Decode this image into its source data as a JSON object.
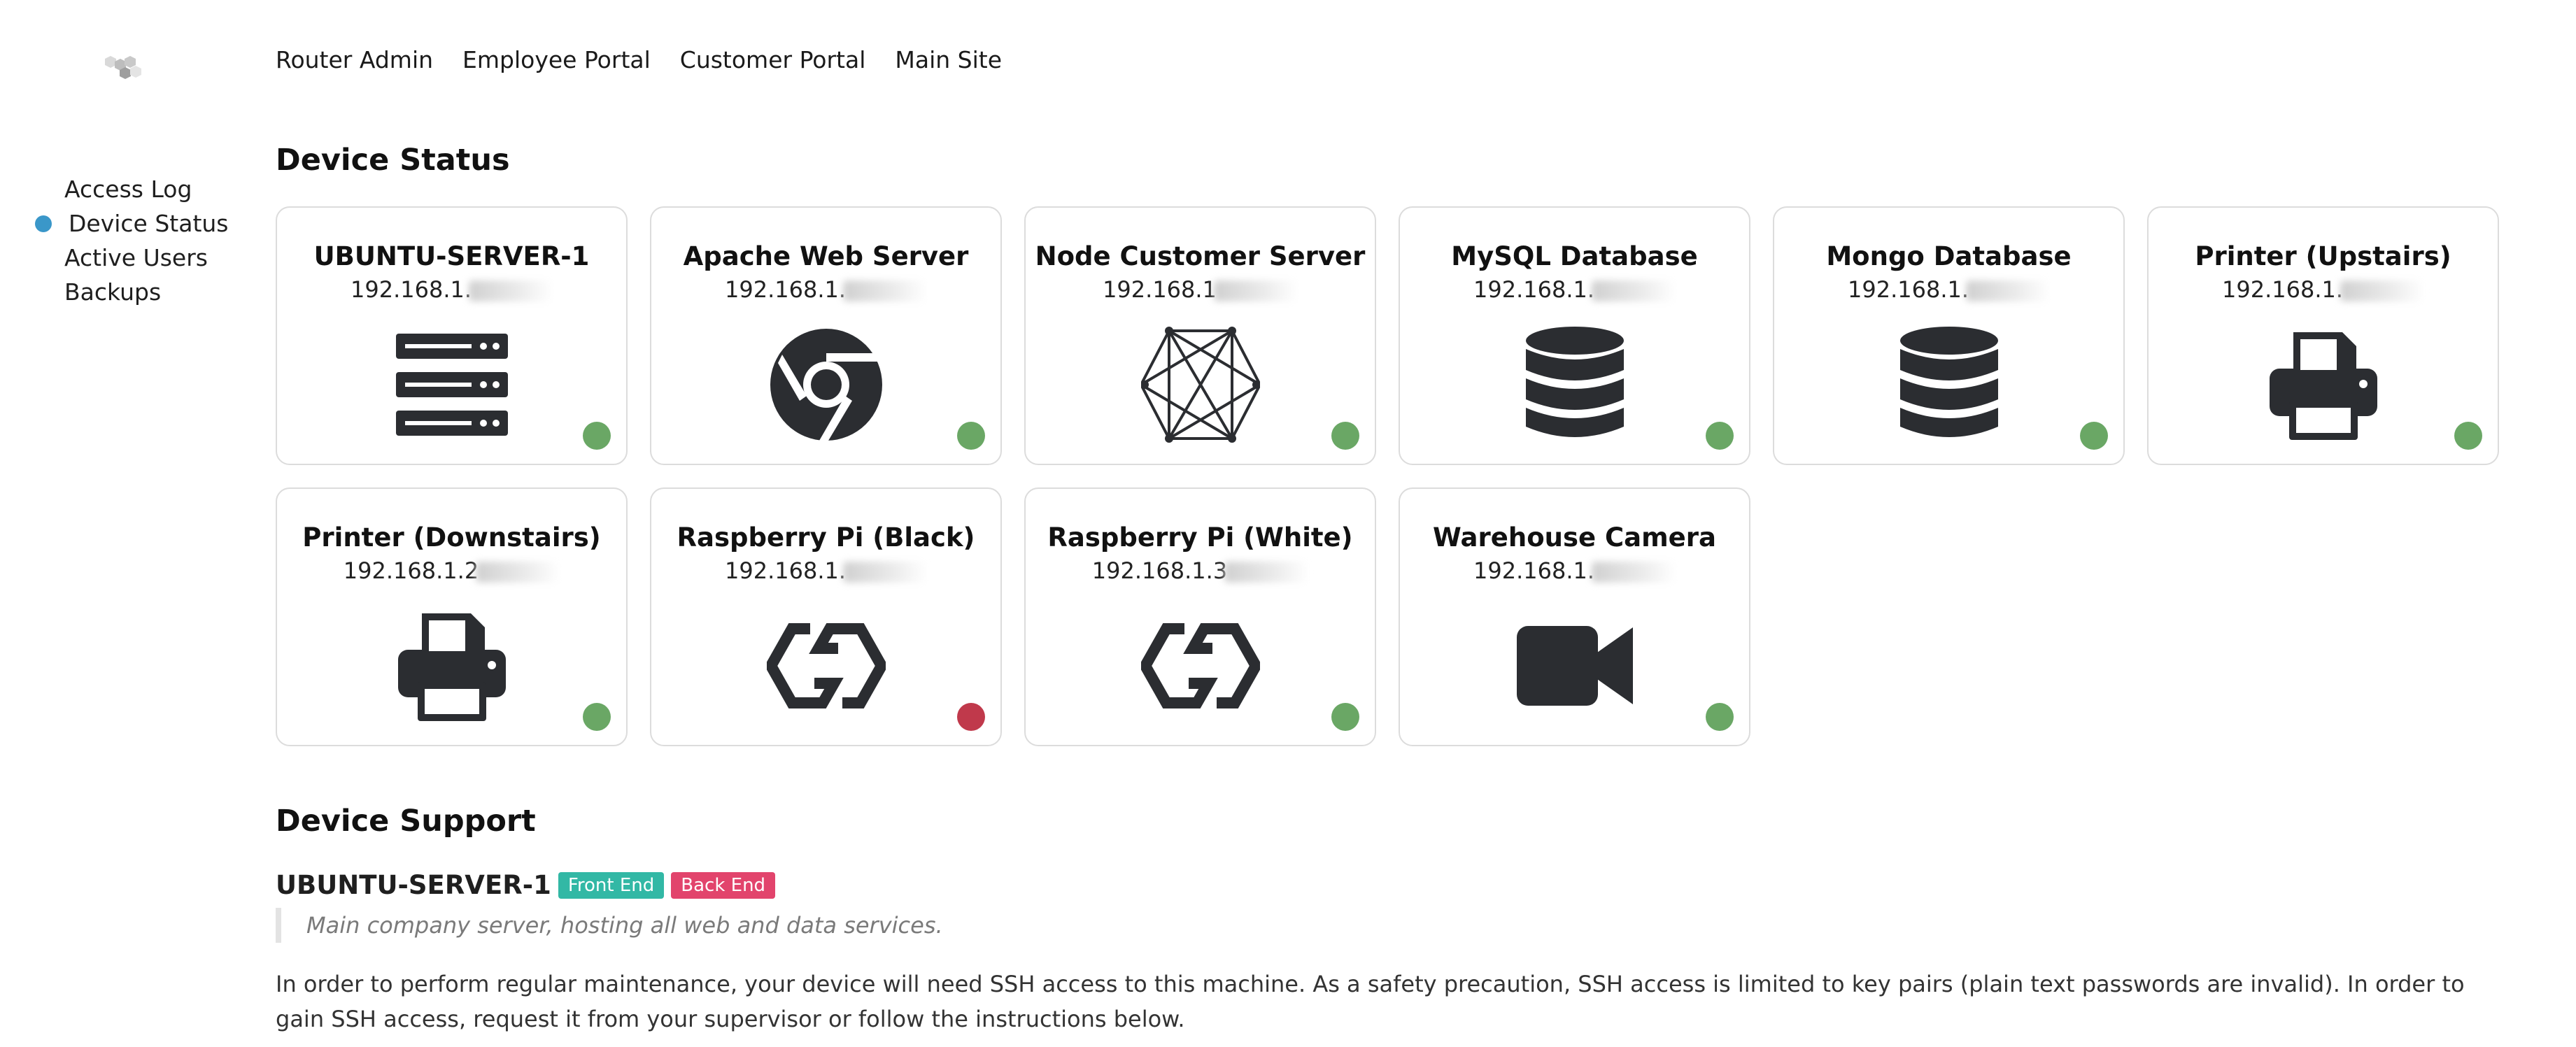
{
  "logo": "hexagon-cluster-logo",
  "topnav": [
    "Router Admin",
    "Employee Portal",
    "Customer Portal",
    "Main Site"
  ],
  "sidenav": {
    "items": [
      {
        "label": "Access Log",
        "active": false
      },
      {
        "label": "Device Status",
        "active": true
      },
      {
        "label": "Active Users",
        "active": false
      },
      {
        "label": "Backups",
        "active": false
      }
    ]
  },
  "device_status": {
    "heading": "Device Status",
    "devices": [
      {
        "name": "UBUNTU-SERVER-1",
        "ip": "192.168.1.",
        "icon": "server-icon",
        "status": "online"
      },
      {
        "name": "Apache Web Server",
        "ip": "192.168.1.",
        "icon": "chrome-icon",
        "status": "online"
      },
      {
        "name": "Node Customer Server",
        "ip": "192.168.1",
        "icon": "hexagon-network-icon",
        "status": "online"
      },
      {
        "name": "MySQL Database",
        "ip": "192.168.1.",
        "icon": "database-icon",
        "status": "online"
      },
      {
        "name": "Mongo Database",
        "ip": "192.168.1.",
        "icon": "database-icon",
        "status": "online"
      },
      {
        "name": "Printer (Upstairs)",
        "ip": "192.168.1.",
        "icon": "printer-icon",
        "status": "online"
      },
      {
        "name": "Printer (Downstairs)",
        "ip": "192.168.1.2",
        "icon": "printer-icon",
        "status": "online"
      },
      {
        "name": "Raspberry Pi (Black)",
        "ip": "192.168.1.",
        "icon": "link-icon",
        "status": "offline"
      },
      {
        "name": "Raspberry Pi (White)",
        "ip": "192.168.1.3",
        "icon": "link-icon",
        "status": "online"
      },
      {
        "name": "Warehouse Camera",
        "ip": "192.168.1.",
        "icon": "video-camera-icon",
        "status": "online"
      }
    ],
    "colors": {
      "online": "#6aa765",
      "offline": "#c0394b"
    }
  },
  "device_support": {
    "heading": "Device Support",
    "device_name": "UBUNTU-SERVER-1",
    "badges": [
      {
        "label": "Front End",
        "color": "#32b8a5"
      },
      {
        "label": "Back End",
        "color": "#e2446c"
      }
    ],
    "description": "Main company server, hosting all web and data services.",
    "paragraph": "In order to perform regular maintenance, your device will need SSH access to this machine. As a safety precaution, SSH access is limited to key pairs (plain text passwords are invalid). In order to gain SSH access, request it from your supervisor or follow the instructions below."
  }
}
